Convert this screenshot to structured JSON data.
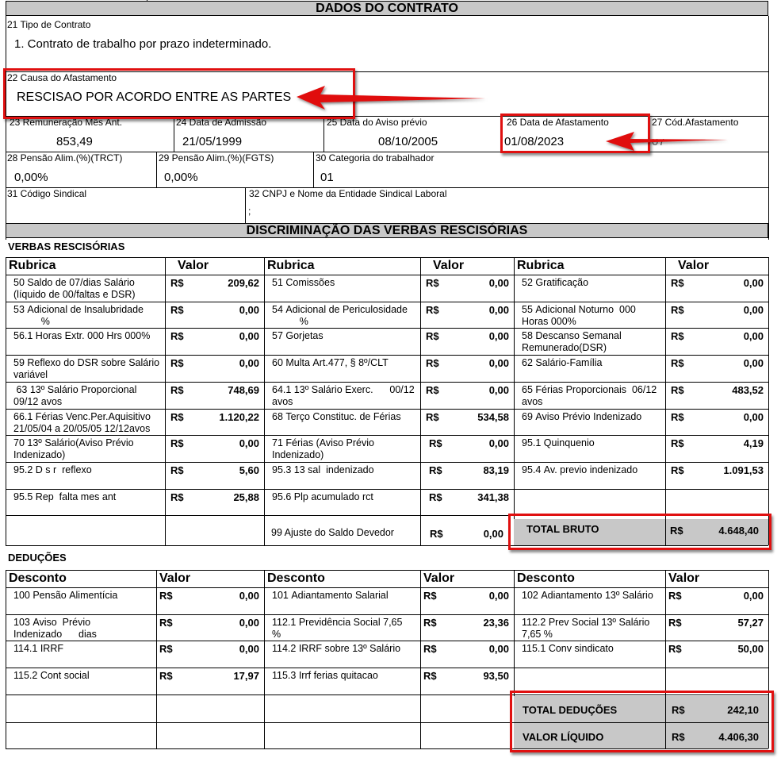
{
  "header": {
    "title": "DADOS DO CONTRATO"
  },
  "contract": {
    "f21_label": "21 Tipo de Contrato",
    "f21_value": "1. Contrato de trabalho por prazo indeterminado.",
    "f22_label": "22 Causa  do Afastamento",
    "f22_value": "RESCISAO POR ACORDO ENTRE AS PARTES",
    "f23_label": "23 Remuneração Mês Ant.",
    "f23_value": "853,49",
    "f24_label": "24 Data de Admissão",
    "f24_value": "21/05/1999",
    "f25_label": "25 Data do Aviso prévio",
    "f25_value": "08/10/2005",
    "f26_label": "26 Data  de Afastamento",
    "f26_value": "01/08/2023",
    "f27_label": "27 Cód.Afastamento",
    "f27_value": "07",
    "f28_label": "28 Pensão Alim.(%)(TRCT)",
    "f28_value": "0,00%",
    "f29_label": "29 Pensão Alim.(%)(FGTS)",
    "f29_value": "0,00%",
    "f30_label": "30 Categoria do trabalhador",
    "f30_value": "01",
    "f31_label": "31 Código Sindical",
    "f32_label": "32 CNPJ  e Nome da Entidade Sindical Laboral",
    "f32_value": ";"
  },
  "verbas": {
    "title": "DISCRIMINAÇÃO  DAS VERBAS RESCISÓRIAS",
    "section": "VERBAS RESCISÓRIAS",
    "col_rubrica": "Rubrica",
    "col_valor": "Valor",
    "currency": "R$",
    "rows": [
      [
        {
          "label": "50 Saldo de 07/dias Salário\n(líquido de 00/faltas e DSR)",
          "value": "209,62"
        },
        {
          "label": "51 Comissões",
          "value": "0,00"
        },
        {
          "label": "52 Gratificação",
          "value": "0,00"
        }
      ],
      [
        {
          "label": "53 Adicional de Insalubridade\n          %",
          "value": "0,00"
        },
        {
          "label": "54 Adicional de Periculosidade\n          %",
          "value": "0,00"
        },
        {
          "label": "55 Adicional Noturno  000\nHoras 000%",
          "value": "0,00"
        }
      ],
      [
        {
          "label": "56.1 Horas Extr. 000 Hrs 000%",
          "value": "0,00"
        },
        {
          "label": "57 Gorjetas",
          "value": "0,00"
        },
        {
          "label": "58 Descanso Semanal\nRemunerado(DSR)",
          "value": "0,00"
        }
      ],
      [
        {
          "label": "59 Reflexo do DSR sobre Salário\nvariável",
          "value": "0,00"
        },
        {
          "label": "60 Multa Art.477, § 8º/CLT",
          "value": "0,00"
        },
        {
          "label": "62 Salário-Família",
          "value": "0,00"
        }
      ],
      [
        {
          "label": " 63 13º Salário Proporcional\n09/12 avos",
          "value": "748,69"
        },
        {
          "label": "64.1 13º Salário Exerc.      00/12\navos",
          "value": "0,00"
        },
        {
          "label": "65 Férias Proporcionais  06/12\navos",
          "value": "483,52"
        }
      ],
      [
        {
          "label": "66.1 Férias Venc.Per.Aquisitivo\n21/05/04 a 20/05/05 12/12avos",
          "value": "1.120,22"
        },
        {
          "label": "68 Terço Constituc. de Férias",
          "value": "534,58"
        },
        {
          "label": "69 Aviso Prévio Indenizado",
          "value": "0,00"
        }
      ],
      [
        {
          "label": "70 13º Salário(Aviso Prévio\nIndenizado)",
          "value": "0,00"
        },
        {
          "label": "71 Férias (Aviso Prévio\nIndenizado)",
          "value": "0,00"
        },
        {
          "label": "95.1 Quinquenio",
          "value": "4,19"
        }
      ],
      [
        {
          "label": "95.2 D s r  reflexo",
          "value": "5,60"
        },
        {
          "label": "95.3 13 sal  indenizado",
          "value": "83,19"
        },
        {
          "label": "95.4 Av. previo indenizado",
          "value": "1.091,53"
        }
      ],
      [
        {
          "label": "95.5 Rep  falta mes ant",
          "value": "25,88"
        },
        {
          "label": "95.6 Plp acumulado rct",
          "value": "341,38"
        },
        null
      ]
    ],
    "ajuste_label": "99 Ajuste do Saldo Devedor",
    "ajuste_value": "0,00",
    "total_bruto_label": "TOTAL BRUTO",
    "total_bruto_value": "4.648,40"
  },
  "deducoes": {
    "section": "DEDUÇÕES",
    "col_desconto": "Desconto",
    "col_valor": "Valor",
    "rows": [
      [
        {
          "label": "100 Pensão Alimentícia",
          "value": "0,00"
        },
        {
          "label": "101 Adiantamento Salarial",
          "value": "0,00"
        },
        {
          "label": "102 Adiantamento 13º Salário",
          "value": "0,00"
        }
      ],
      [
        {
          "label": "103 Aviso  Prévio\nIndenizado      dias",
          "value": "0,00"
        },
        {
          "label": "112.1 Previdência Social 7,65\n%",
          "value": "23,36"
        },
        {
          "label": "112.2 Prev Social 13º Salário\n7,65 %",
          "value": "57,27"
        }
      ],
      [
        {
          "label": "114.1 IRRF",
          "value": "0,00"
        },
        {
          "label": "114.2 IRRF sobre 13º Salário",
          "value": "0,00"
        },
        {
          "label": "115.1 Conv sindicato",
          "value": "50,00"
        }
      ],
      [
        {
          "label": "115.2 Cont social",
          "value": "17,97"
        },
        {
          "label": "115.3 Irrf ferias quitacao",
          "value": "93,50"
        },
        null
      ]
    ],
    "total_deducoes_label": "TOTAL  DEDUÇÕES",
    "total_deducoes_value": "242,10",
    "valor_liquido_label": "VALOR LÍQUIDO",
    "valor_liquido_value": "4.406,30"
  },
  "colors": {
    "highlight": "#e01010",
    "header_bg": "#c8c8c8"
  }
}
